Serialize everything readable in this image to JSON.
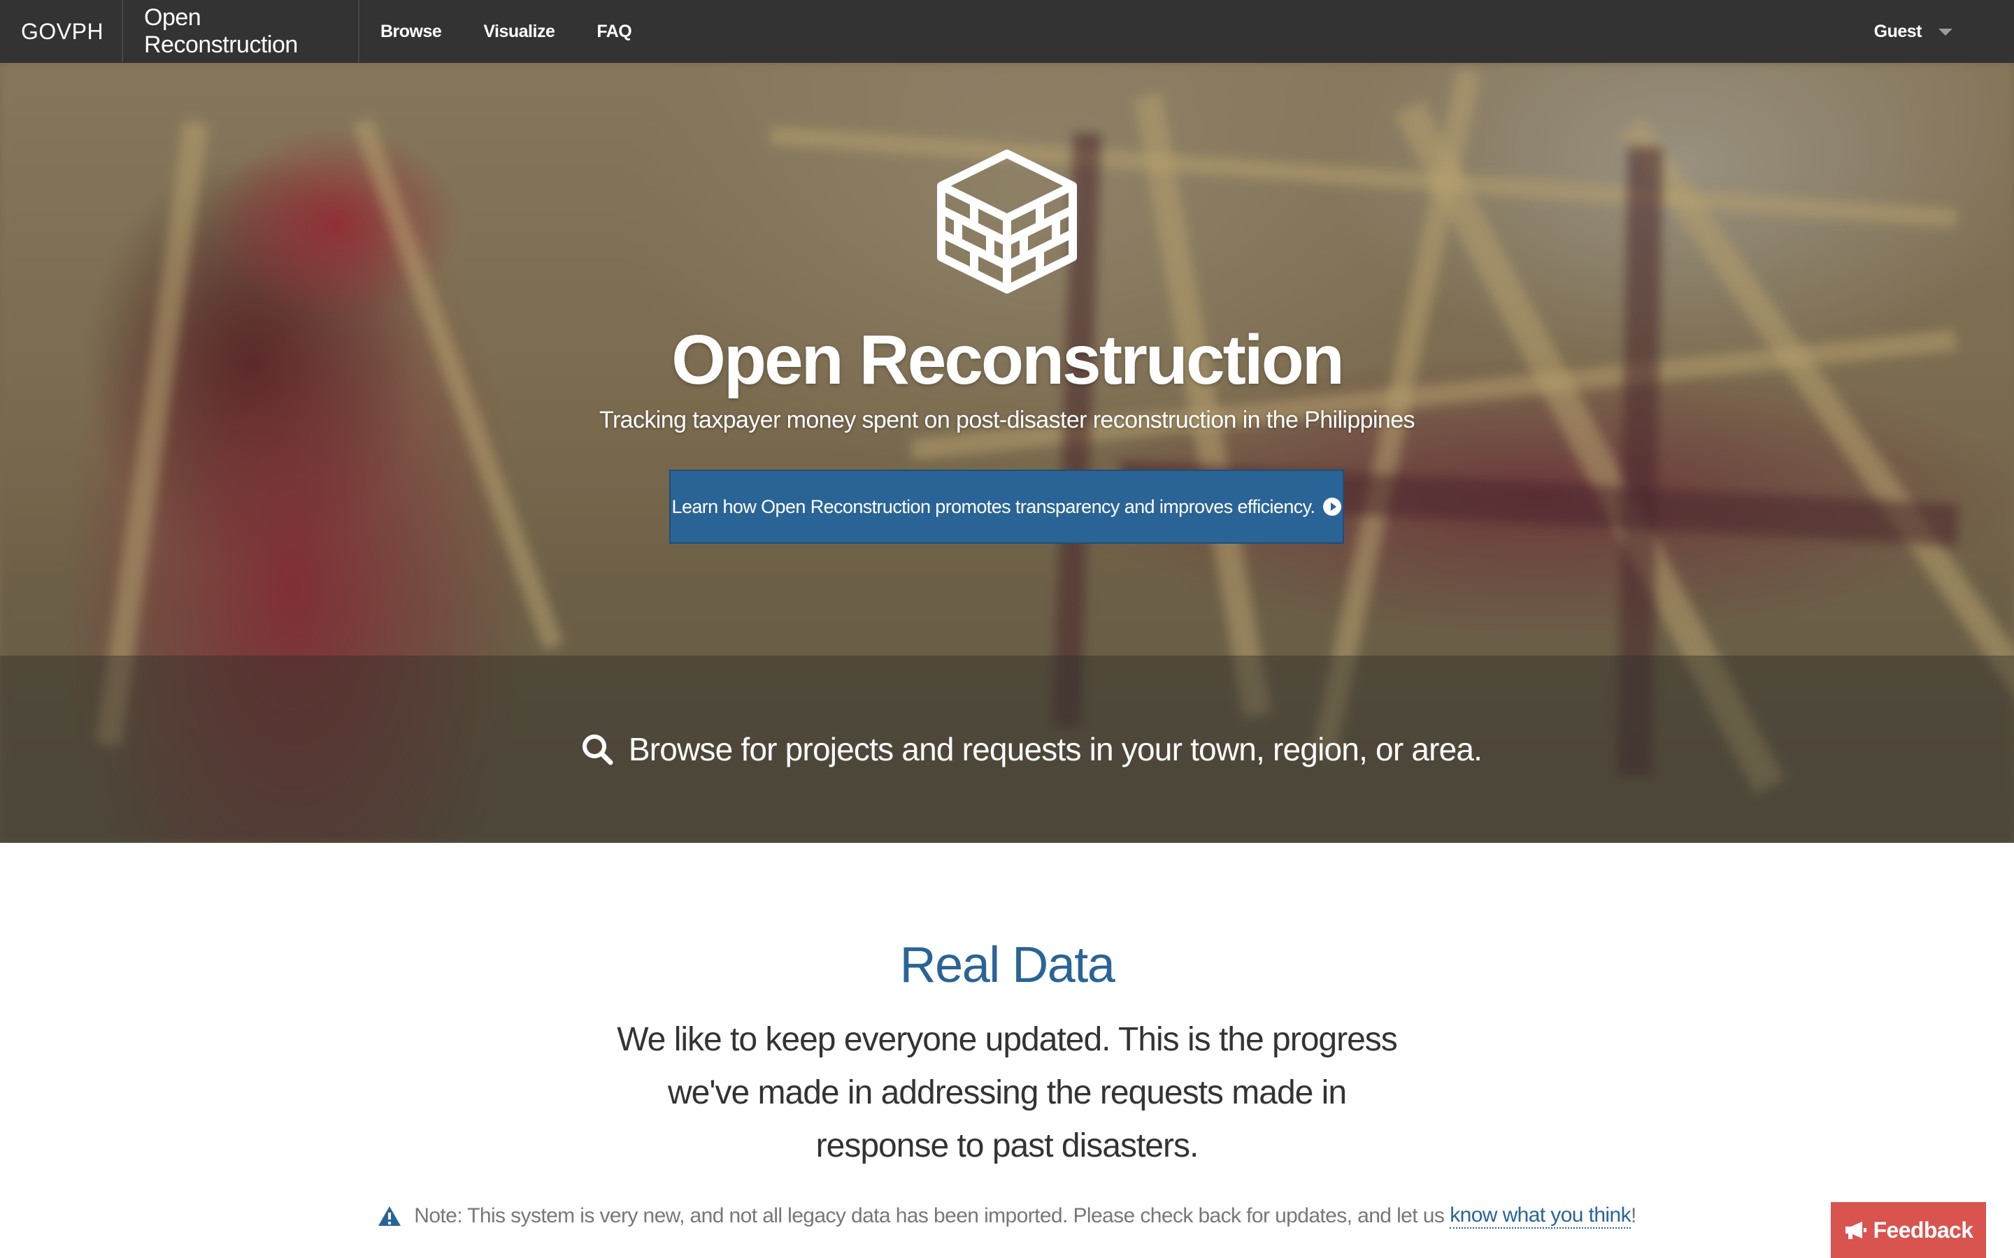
{
  "navbar": {
    "govph": "GOVPH",
    "brand": "Open Reconstruction",
    "links": [
      "Browse",
      "Visualize",
      "FAQ"
    ],
    "user": "Guest"
  },
  "hero": {
    "title": "Open Reconstruction",
    "subtitle": "Tracking taxpayer money spent on post-disaster reconstruction in the Philippines",
    "cta_label": "Learn how Open Reconstruction promotes transparency and improves efficiency.",
    "browse_text": "Browse for projects and requests in your town, region, or area.",
    "logo_icon": "brick-cube-icon",
    "search_icon": "search-icon"
  },
  "content": {
    "title": "Real Data",
    "description": "We like to keep everyone updated. This is the progress we've made in addressing the requests made in response to past disasters.",
    "note_text": "Note: This system is very new, and not all legacy data has been imported. Please check back for updates, and let us",
    "note_link": "know what you think",
    "note_end": "!",
    "note_icon": "warning-icon"
  },
  "feedback": {
    "label": "Feedback",
    "icon": "megaphone-icon"
  },
  "colors": {
    "navbar": "#333333",
    "primary": "#2a6496",
    "feedback": "#d9534f",
    "text": "#333333",
    "muted": "#777777"
  }
}
